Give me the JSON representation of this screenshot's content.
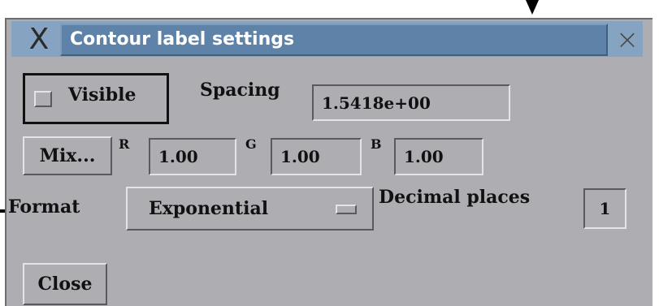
{
  "window": {
    "title": "Contour label settings",
    "close_glyph": "×",
    "app_icon_glyph": "X"
  },
  "visible": {
    "label": "Visible",
    "checked": false
  },
  "spacing": {
    "label": "Spacing",
    "value": "1.5418e+00"
  },
  "color": {
    "mix_label": "Mix...",
    "r_label": "R",
    "r_value": "1.00",
    "g_label": "G",
    "g_value": "1.00",
    "b_label": "B",
    "b_value": "1.00"
  },
  "format": {
    "label": "Format",
    "selected": "Exponential"
  },
  "decimal_places": {
    "label": "Decimal places",
    "value": "1"
  },
  "footer": {
    "close_label": "Close"
  },
  "colors": {
    "dialog_bg": "#aeadb2",
    "titlebar_bg": "#5e82a8",
    "titlebar_text": "#ffffff"
  },
  "icons": {
    "app": "x-window-icon",
    "close": "close-icon",
    "dropdown": "dropdown-indicator-icon"
  }
}
